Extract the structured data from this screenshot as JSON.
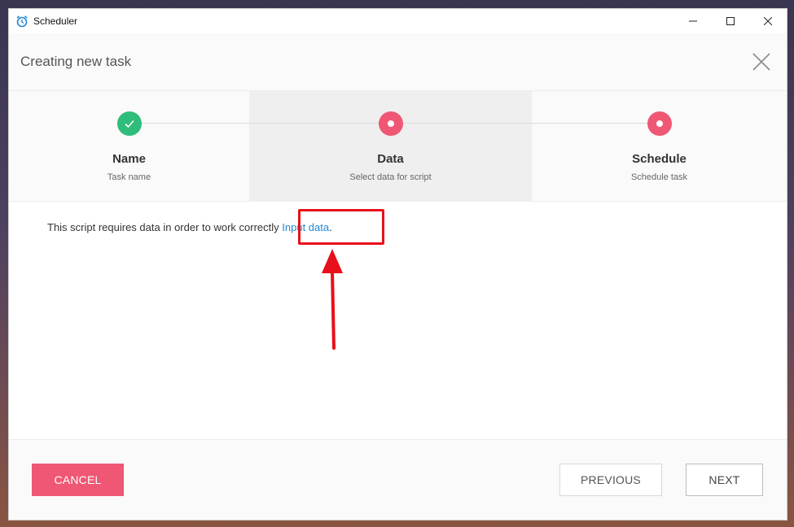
{
  "window": {
    "app_title": "Scheduler",
    "icons": {
      "app": "alarm-clock-icon",
      "minimize": "minimize-icon",
      "maximize": "maximize-icon",
      "close": "close-icon"
    }
  },
  "header": {
    "title": "Creating new task",
    "close_icon": "close-icon"
  },
  "steps": [
    {
      "title": "Name",
      "subtitle": "Task name",
      "state": "completed",
      "icon": "checkmark-icon"
    },
    {
      "title": "Data",
      "subtitle": "Select data for script",
      "state": "active",
      "icon": "dot-icon"
    },
    {
      "title": "Schedule",
      "subtitle": "Schedule task",
      "state": "pending",
      "icon": "dot-icon"
    }
  ],
  "content": {
    "message": "This script requires data in order to work correctly",
    "link_text": "Input data",
    "link_suffix": "."
  },
  "footer": {
    "cancel_label": "CANCEL",
    "previous_label": "PREVIOUS",
    "next_label": "NEXT"
  },
  "colors": {
    "accent": "#ef5774",
    "success": "#2ebd7a",
    "link": "#1e88d6",
    "annotation": "#e8101a"
  }
}
